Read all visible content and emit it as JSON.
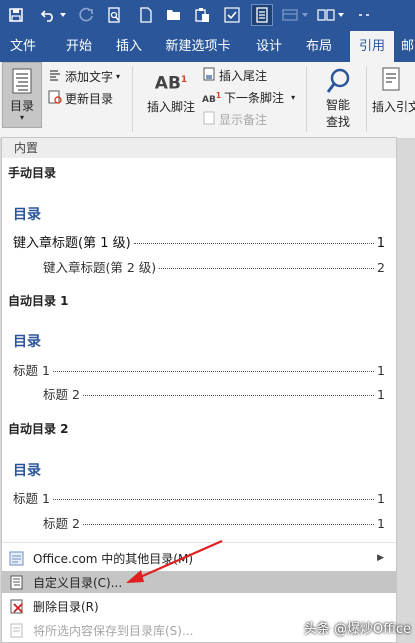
{
  "tabs": [
    "文件",
    "开始",
    "插入",
    "新建选项卡",
    "设计",
    "布局",
    "引用",
    "邮"
  ],
  "ribbon": {
    "toc_button": "目录",
    "add_text": "添加文字",
    "update_toc": "更新目录",
    "insert_footnote": "插入脚注",
    "insert_endnote": "插入尾注",
    "next_footnote": "下一条脚注",
    "show_notes": "显示备注",
    "smart_lookup_1": "智能",
    "smart_lookup_2": "查找",
    "insert_citation": "插入引文"
  },
  "gallery": {
    "header": "内置",
    "sections": [
      {
        "title": "手动目录",
        "heading": "目录",
        "lines": [
          {
            "text": "键入章标题(第  1  级)",
            "page": "1"
          },
          {
            "text": "键入章标题(第  2  级)",
            "page": "2"
          }
        ]
      },
      {
        "title": "自动目录 1",
        "heading": "目录",
        "lines": [
          {
            "text": "标题  1",
            "page": "1"
          },
          {
            "text": "标题  2",
            "page": "1"
          }
        ]
      },
      {
        "title": "自动目录 2",
        "heading": "目录",
        "lines": [
          {
            "text": "标题  1",
            "page": "1"
          },
          {
            "text": "标题  2",
            "page": "1"
          }
        ]
      }
    ],
    "menu": [
      {
        "label": "Office.com 中的其他目录(M)"
      },
      {
        "label": "自定义目录(C)..."
      },
      {
        "label": "删除目录(R)"
      },
      {
        "label": "将所选内容保存到目录库(S)..."
      }
    ]
  },
  "watermark": "头条 @爆炒Office",
  "colors": {
    "accent": "#2b579a",
    "heading": "#2b579a",
    "arrow": "#e02020"
  }
}
